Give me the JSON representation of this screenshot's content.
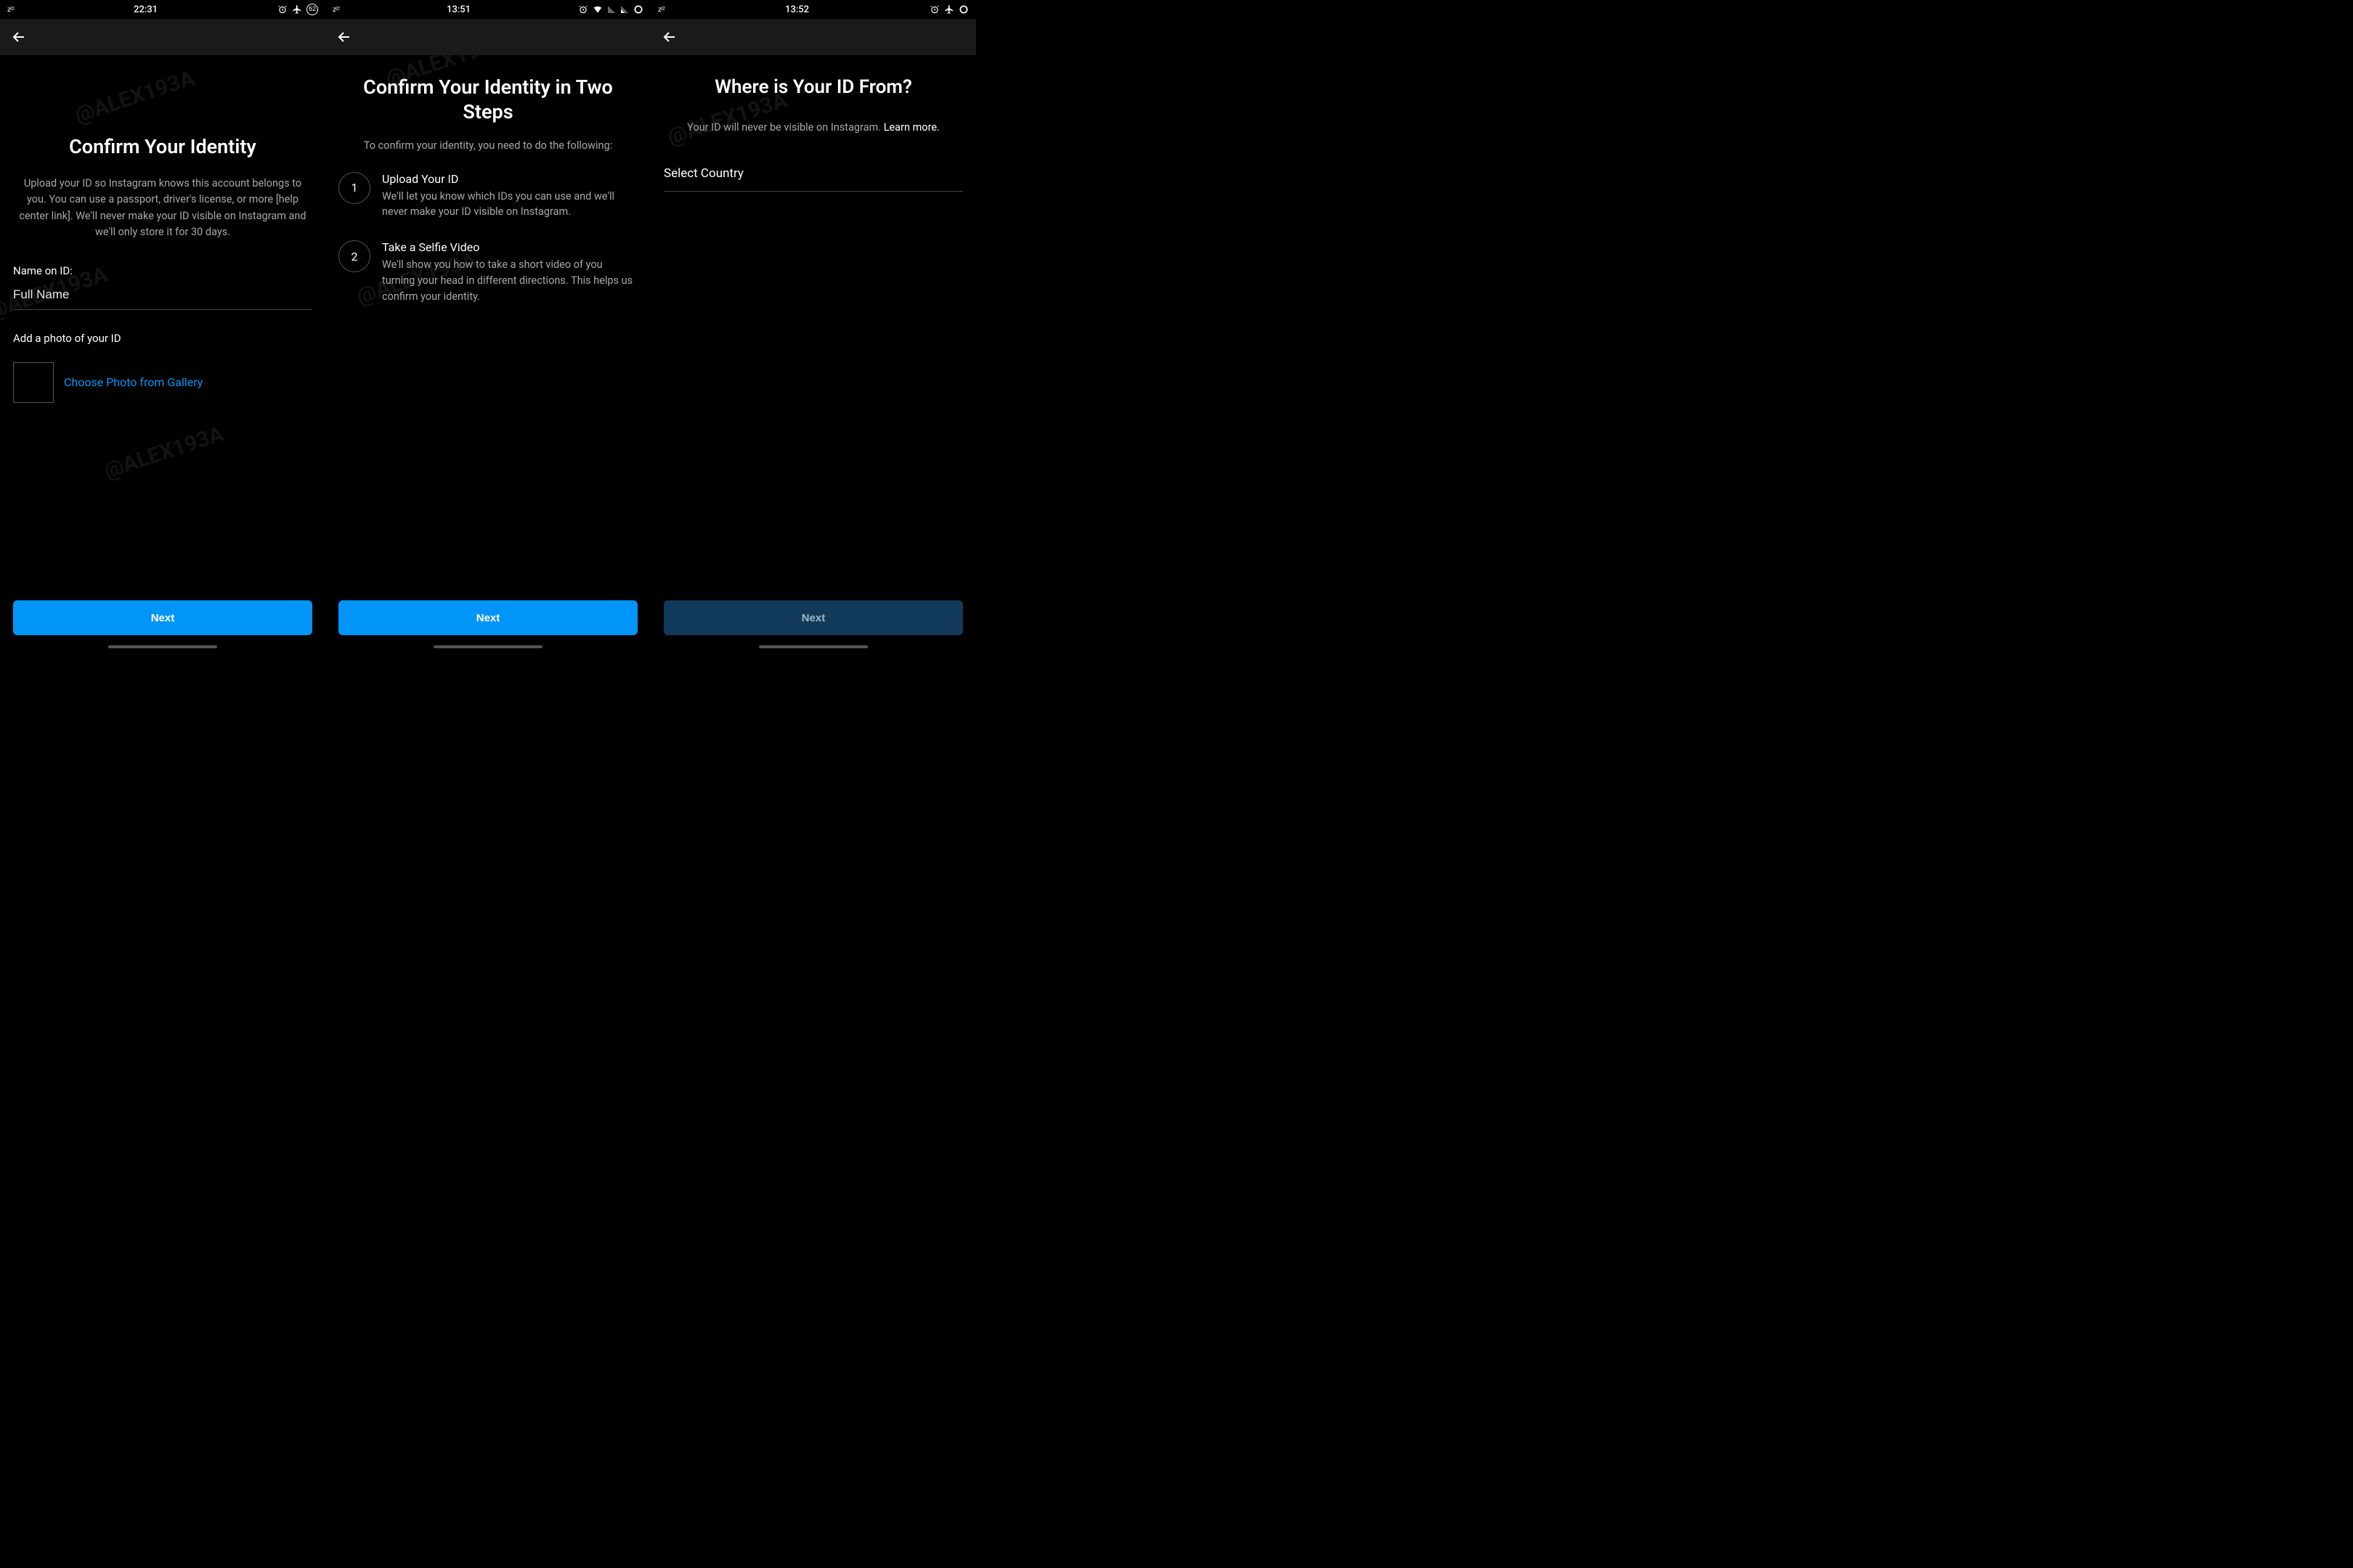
{
  "watermark": "@ALEX193A",
  "screens": [
    {
      "status": {
        "time": "22:31",
        "sleep": "zᶻᶻ",
        "battery": "62"
      },
      "title": "Confirm Your Identity",
      "subtext": "Upload your ID so Instagram knows this account belongs to you. You can use a passport, driver's license, or more [help center link]. We'll never make your ID visible on Instagram and we'll only store it for 30 days.",
      "name_label": "Name on ID:",
      "name_placeholder": "Full Name",
      "photo_label": "Add a photo of your ID",
      "choose_link": "Choose Photo from Gallery",
      "next": "Next"
    },
    {
      "status": {
        "time": "13:51",
        "sleep": "zᶻᶻ"
      },
      "title": "Confirm Your Identity in Two Steps",
      "intro": "To confirm your identity, you need to do the following:",
      "steps": [
        {
          "n": "1",
          "title": "Upload Your ID",
          "desc": "We'll let you know which IDs you can use and we'll never make your ID visible on Instagram."
        },
        {
          "n": "2",
          "title": "Take a Selfie Video",
          "desc": "We'll show you how to take a short video of you turning your head in different directions. This helps us confirm your identity."
        }
      ],
      "next": "Next"
    },
    {
      "status": {
        "time": "13:52",
        "sleep": "zᶻᶻ"
      },
      "title": "Where is Your ID From?",
      "subtext": "Your ID will never be visible on Instagram. ",
      "learn_more": "Learn more.",
      "select_label": "Select Country",
      "next": "Next"
    }
  ]
}
